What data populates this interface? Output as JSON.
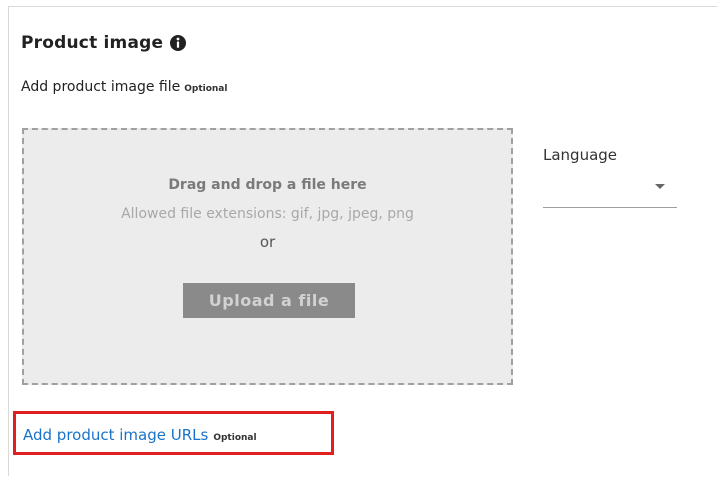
{
  "section": {
    "title": "Product image",
    "info_icon": "info-circle-icon",
    "subtitle": "Add product image file",
    "optional_tag": "Optional"
  },
  "dropzone": {
    "title": "Drag and drop a file here",
    "extensions": "Allowed file extensions: gif, jpg, jpeg, png",
    "or": "or",
    "upload_label": "Upload a file"
  },
  "language": {
    "label": "Language",
    "value": "",
    "icon": "caret-down-icon"
  },
  "url_link": {
    "label": "Add product image URLs",
    "optional_tag": "Optional"
  },
  "colors": {
    "link": "#1a73c8",
    "highlight": "#e02020",
    "dropzone_bg": "#ececec",
    "button_bg": "#8a8a8a"
  }
}
